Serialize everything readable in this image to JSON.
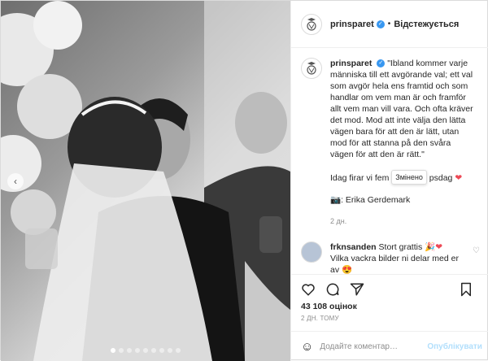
{
  "account": {
    "username": "prinsparet",
    "follow_label": "Відстежується",
    "separator": "•"
  },
  "caption": {
    "username": "prinsparet",
    "quote": "\"Ibland kommer varje människa till ett avgörande val; ett val som avgör hela ens framtid och som handlar om vem man är och framför allt vem man vill vara. Och ofta kräver det mod. Mod att inte välja den lätta vägen bara för att den är lätt, utan mod för att stanna på den svåra vägen för att den är rätt.\"",
    "line2_start": "Idag firar vi fem",
    "line2_end": "psdag",
    "edited_tooltip": "Змінено",
    "heart": "❤",
    "photographer_emoji": "📷",
    "photographer": ": Erika Gerdemark",
    "age": "2 дн."
  },
  "comments": [
    {
      "username": "frknsanden",
      "text": "Stort grattis",
      "emojis": "🎉❤",
      "text2": "Vilka vackra bilder ni delar med er av",
      "emoji2": "😍"
    }
  ],
  "stats": {
    "likes": "43 108 оцінок",
    "time": "2 ДН. ТОМУ"
  },
  "comment_box": {
    "placeholder": "Додайте коментар…",
    "post_label": "Опублікувати"
  },
  "carousel": {
    "count": 9,
    "active_index": 0
  },
  "colors": {
    "verified_blue": "#3897f0",
    "heart_red": "#ed4956",
    "post_disabled": "#b2dffc"
  }
}
